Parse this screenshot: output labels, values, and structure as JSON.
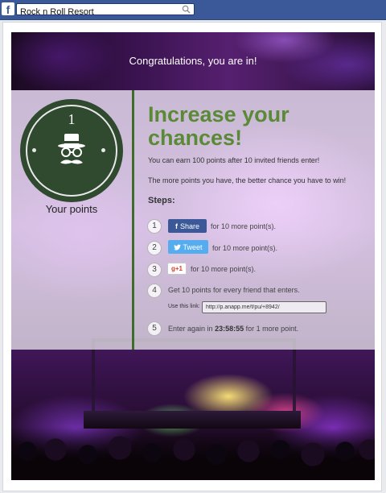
{
  "topbar": {
    "logo": "f",
    "search_value": "Rock n Roll Resort",
    "search_icon": "search-icon"
  },
  "banner": {
    "title": "Congratulations, you are in!"
  },
  "points": {
    "value": "1",
    "label": "Your points",
    "icon": "hat-glasses-mustache-icon"
  },
  "content": {
    "headline": "Increase your chances!",
    "line1": "You can earn 100 points after 10 invited friends enter!",
    "line2": "The more points you have, the better chance you have to win!",
    "steps_label": "Steps:"
  },
  "steps": [
    {
      "num": "1",
      "button": "Share",
      "text": "for 10 more point(s)."
    },
    {
      "num": "2",
      "button": "Tweet",
      "text": "for 10 more point(s)."
    },
    {
      "num": "3",
      "button": "g+1",
      "text": "for 10 more point(s)."
    },
    {
      "num": "4",
      "text": "Get 10 points for every friend that enters.",
      "link_label": "Use this link:",
      "link_value": "http://p.anapp.me/f/pu/+8942/"
    },
    {
      "num": "5",
      "text_before": "Enter again in",
      "countdown": "23:58:55",
      "text_after": "for 1 more point."
    }
  ],
  "colors": {
    "fb_bar": "#3b5998",
    "accent_green": "#5b8a37",
    "badge_dark": "#2f4a2f",
    "share_blue": "#3b5998",
    "tweet_blue": "#55acee",
    "gplus_red": "#d73d32"
  }
}
